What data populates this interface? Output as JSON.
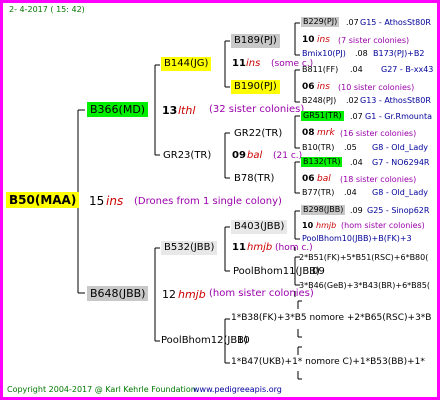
{
  "header": {
    "date": "2- 4-2017 ( 15: 42)"
  },
  "footer": {
    "copyright": "Copyright 2004-2017 @ Karl Kehrle Foundation.",
    "site": "www.pedigreeapis.org"
  },
  "root": {
    "name": "B50(MAA)",
    "gen_num": "15",
    "gen_code": "ins",
    "note": "(Drones from 1 single colony)"
  },
  "mother": {
    "name": "B366(MD)",
    "gen_num": "13",
    "gen_code": "lthl",
    "note": "(32 sister colonies)",
    "dam": {
      "name": "B144(JG)",
      "gen_num": "11",
      "gen_code": "ins",
      "note": "(some c.)",
      "dam": {
        "name": "B189(PJ)",
        "gen_num": "10",
        "gen_code": "ins",
        "note": "(7 sister colonies)",
        "top": {
          "id": "B229(PJ)",
          "year": ".07",
          "breeder": "G15 - AthosSt80R"
        },
        "bot": {
          "id": "Bmix10(PJ)",
          "year": ".08",
          "breeder": "B173(PJ)+B2"
        }
      },
      "sire": {
        "name": "B190(PJ)",
        "gen_num": "06",
        "gen_code": "ins",
        "note": "(10 sister colonies)",
        "top": {
          "id": "B811(FF)",
          "year": ".04",
          "breeder": "G27 - B-xx43"
        },
        "bot": {
          "id": "B248(PJ)",
          "year": ".02",
          "breeder": "G13 - AthosSt80R"
        }
      }
    },
    "sire": {
      "name": "GR23(TR)",
      "gen_num": "09",
      "gen_code": "bal",
      "note": "(21 c.)",
      "dam": {
        "name": "GR22(TR)",
        "gen_num": "08",
        "gen_code": "mrk",
        "note": "(16 sister colonies)",
        "top": {
          "id": "GR51(TR)",
          "year": ".07",
          "breeder": "G1 - Gr.Rmounta"
        },
        "bot": {
          "id": "B10(TR)",
          "year": ".05",
          "breeder": "G8 - Old_Lady"
        }
      },
      "sire": {
        "name": "B78(TR)",
        "gen_num": "06",
        "gen_code": "bal",
        "note": "(18 sister colonies)",
        "top": {
          "id": "B132(TR)",
          "year": ".04",
          "breeder": "G7 - NO6294R"
        },
        "bot": {
          "id": "B77(TR)",
          "year": ".04",
          "breeder": "G8 - Old_Lady"
        }
      }
    }
  },
  "father": {
    "name": "B648(JBB)",
    "gen_num": "12",
    "gen_code": "hmjb",
    "note": "(hom sister colonies)",
    "dam": {
      "name": "B532(JBB)",
      "gen_num": "11",
      "gen_code": "hmjb",
      "note": "(hom c.)",
      "dam": {
        "name": "B403(JBB)",
        "gen_num": "10",
        "gen_code": "hmjb",
        "note": "(hom sister colonies)",
        "top": {
          "id": "B298(JBB)",
          "year": ".09",
          "breeder": "G25 - Sinop62R"
        },
        "bot": {
          "text": "PoolBhom10(JBB)+B(FK)+3"
        }
      },
      "sire": {
        "name": "PoolBhom11(JBB)",
        "year": ".09",
        "top": {
          "text": "2*B51(FK)+5*B51(RSC)+6*B80("
        },
        "bot": {
          "text": "3*B46(GeB)+3*B43(BR)+6*B85("
        }
      }
    },
    "sire": {
      "name": "PoolBhom12(JBB)",
      "year": "10",
      "top": {
        "text": "1*B38(FK)+3*B5 nomore +2*B65(RSC)+3*B"
      },
      "bot": {
        "text": "1*B47(UKB)+1* nomore C)+1*B53(BB)+1*"
      }
    }
  }
}
